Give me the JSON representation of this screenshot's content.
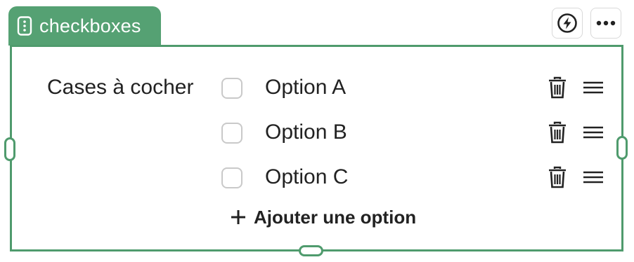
{
  "block": {
    "type_label": "checkboxes",
    "accent_color": "#55a173",
    "icons": {
      "tab": "vertical-dots-icon",
      "action": "lightning-icon",
      "more": "more-options-icon",
      "delete": "trash-icon",
      "reorder": "drag-handle-icon",
      "add": "plus-icon"
    }
  },
  "field": {
    "label": "Cases à cocher",
    "options": [
      {
        "label": "Option A",
        "checked": false
      },
      {
        "label": "Option B",
        "checked": false
      },
      {
        "label": "Option C",
        "checked": false
      }
    ],
    "add_option_label": "Ajouter une option"
  }
}
